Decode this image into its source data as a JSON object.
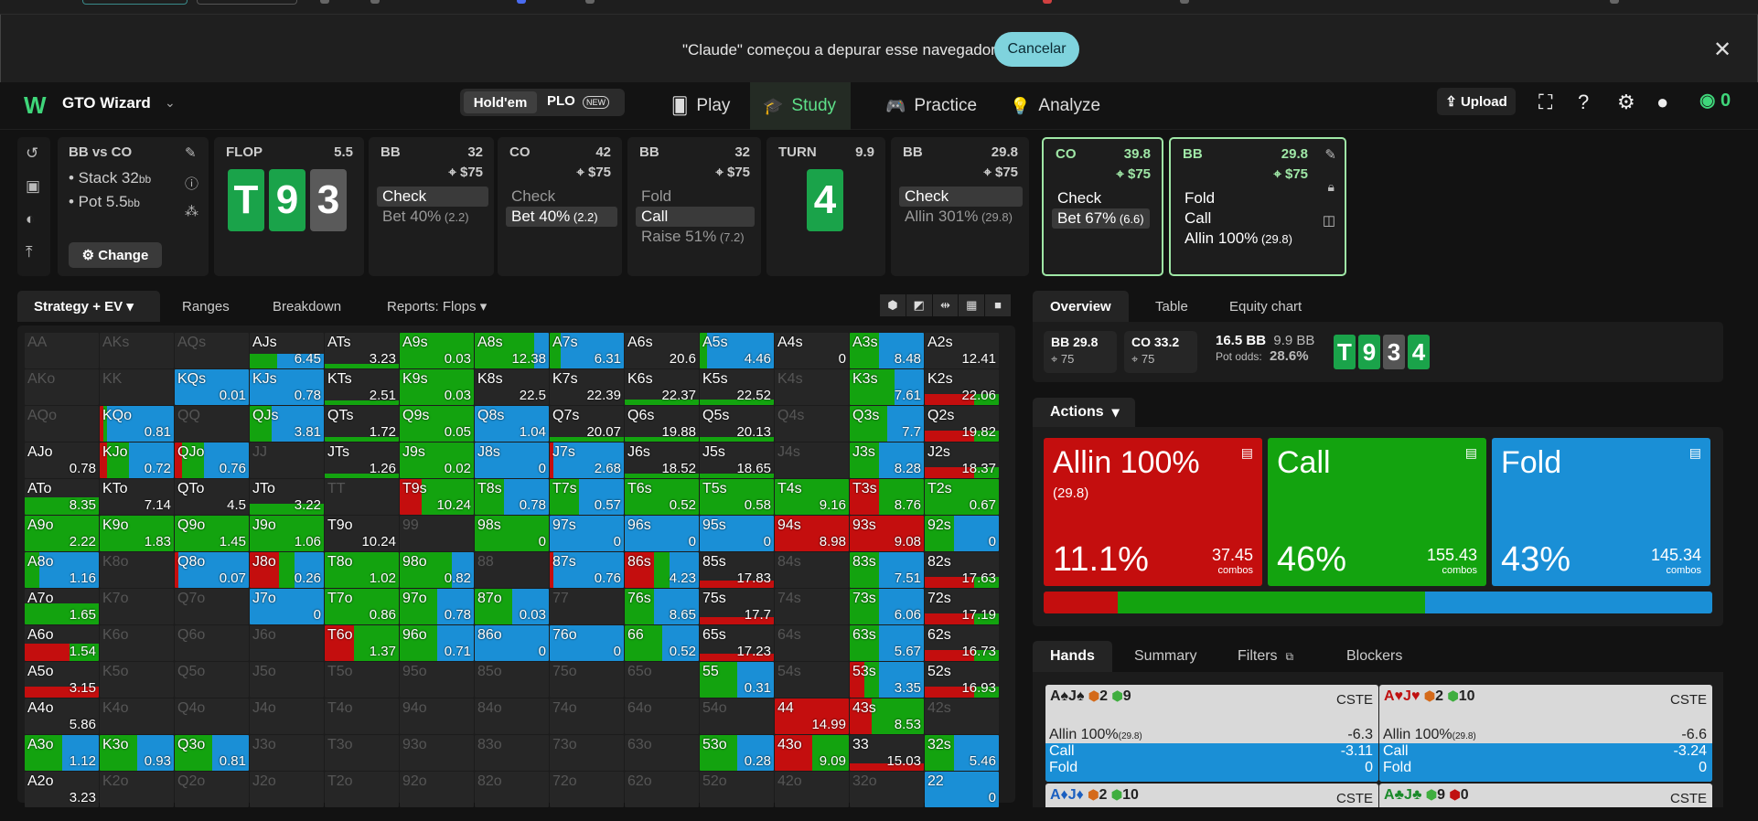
{
  "browser_infobar": {
    "message": "\"Claude\" começou a depurar esse navegador",
    "cancel_label": "Cancelar",
    "close_glyph": "✕"
  },
  "nav": {
    "brand": "GTO Wizard",
    "logo": "W",
    "game_holdem": "Hold'em",
    "game_plo": "PLO",
    "new_badge": "NEW",
    "play": "Play",
    "study": "Study",
    "practice": "Practice",
    "analyze": "Analyze",
    "upload": "Upload",
    "score": "0"
  },
  "spot": {
    "title": "BB vs CO",
    "stack": "• Stack 32",
    "stack_unit": "bb",
    "pot": "• Pot 5.5",
    "pot_unit": "bb",
    "change": "Change"
  },
  "flop": {
    "label": "FLOP",
    "pot": "5.5",
    "cards": [
      "T",
      "9",
      "3"
    ]
  },
  "turn": {
    "label": "TURN",
    "pot": "9.9",
    "card": "4"
  },
  "nodes": [
    {
      "pos": "BB",
      "stack": "32",
      "pot": "⌖ $75",
      "actions": [
        {
          "t": "Check",
          "s": ""
        },
        {
          "t": "Bet 40%",
          "s": " (2.2)"
        }
      ]
    },
    {
      "pos": "CO",
      "stack": "42",
      "pot": "⌖ $75",
      "actions": [
        {
          "t": "Check",
          "s": ""
        },
        {
          "t": "Bet 40%",
          "s": " (2.2)"
        }
      ]
    },
    {
      "pos": "BB",
      "stack": "32",
      "pot": "⌖ $75",
      "actions": [
        {
          "t": "Fold",
          "s": ""
        },
        {
          "t": "Call",
          "s": ""
        },
        {
          "t": "Raise 51%",
          "s": " (7.2)"
        }
      ]
    },
    {
      "pos": "BB",
      "stack": "29.8",
      "pot": "⌖ $75",
      "actions": [
        {
          "t": "Check",
          "s": ""
        },
        {
          "t": "Allin 301%",
          "s": " (29.8)"
        }
      ]
    },
    {
      "pos": "CO",
      "stack": "39.8",
      "pot": "⌖ $75",
      "actions": [
        {
          "t": "Check",
          "s": ""
        },
        {
          "t": "Bet 67%",
          "s": " (6.6)"
        }
      ]
    },
    {
      "pos": "BB",
      "stack": "29.8",
      "pot": "⌖ $75",
      "actions": [
        {
          "t": "Fold",
          "s": ""
        },
        {
          "t": "Call",
          "s": ""
        },
        {
          "t": "Allin 100%",
          "s": " (29.8)"
        }
      ]
    }
  ],
  "subtabs": {
    "strategy": "Strategy + EV",
    "ranges": "Ranges",
    "breakdown": "Breakdown",
    "reports": "Reports: Flops"
  },
  "right_tabs": {
    "overview": "Overview",
    "table": "Table",
    "equity": "Equity chart"
  },
  "overview": {
    "bb": "BB 29.8",
    "bb_pp": "⌖ 75",
    "co": "CO 33.2",
    "co_pp": "⌖ 75",
    "pot_main": "16.5 BB",
    "pot_side": "9.9 BB",
    "pot_odds_label": "Pot odds:",
    "pot_odds": "28.6%",
    "board": [
      "T",
      "9",
      "3",
      "4"
    ]
  },
  "actions_panel": {
    "header": "Actions",
    "boxes": [
      {
        "label": "Allin 100%",
        "size": "(29.8)",
        "pct": "11.1%",
        "combos": "37.45",
        "combos_label": "combos",
        "color": "#c40e0e"
      },
      {
        "label": "Call",
        "size": "",
        "pct": "46%",
        "combos": "155.43",
        "combos_label": "combos",
        "color": "#13a30f"
      },
      {
        "label": "Fold",
        "size": "",
        "pct": "43%",
        "combos": "145.34",
        "combos_label": "combos",
        "color": "#1a8fd6"
      }
    ],
    "freq": [
      0.111,
      0.46,
      0.43
    ]
  },
  "hands_tabs": {
    "hands": "Hands",
    "summary": "Summary",
    "filters": "Filters",
    "blockers": "Blockers"
  },
  "hand_cards": [
    {
      "cards": "A♠J♠",
      "b1": "2",
      "b2": "9",
      "code": "CSTE",
      "allin": "Allin 100%",
      "allin_s": "(29.8)",
      "allin_v": "-6.3",
      "call_v": "-3.11",
      "fold_v": "0"
    },
    {
      "cards": "A♥J♥",
      "b1": "2",
      "b2": "10",
      "code": "CSTE",
      "allin": "Allin 100%",
      "allin_s": "(29.8)",
      "allin_v": "-6.6",
      "call_v": "-3.24",
      "fold_v": "0"
    },
    {
      "cards": "A♦J♦",
      "b1": "2",
      "b2": "10",
      "code": "CSTE"
    },
    {
      "cards": "A♣J♣",
      "b1": "9",
      "b2": "0",
      "code": "CSTE"
    }
  ],
  "labels": {
    "call": "Call",
    "fold": "Fold"
  },
  "colors": {
    "allin": "#c40e0e",
    "call": "#13a30f",
    "fold": "#1a8fd6",
    "accent": "#3fd67a"
  },
  "grid": [
    [
      "AA|x",
      "AKs|x",
      "AQs|x",
      "AJs|6.45|0,15,25",
      "ATs|3.23|0,5,0",
      "A9s|0.03|0,100,0",
      "A8s|12.38|0,80,20",
      "A7s|6.31|0,15,85",
      "A6s|20.6|0,0,0",
      "A5s|4.46|0,10,90",
      "A4s|0|0,0,0",
      "A3s|8.48|0,40,60",
      "A2s|12.41|0,0,0"
    ],
    [
      "AKo|x",
      "KK|x",
      "KQs|0.01|0,0,100",
      "KJs|0.78|0,0,100",
      "KTs|2.51|0,5,0",
      "K9s|0.03|0,100,0",
      "K8s|22.5|0,0,0",
      "K7s|22.39|0,0,0",
      "K6s|22.37|0,15,0",
      "K5s|22.52|0,15,0",
      "K4s|x",
      "K3s|7.61|0,60,40",
      "K2s|22.06|20,10,0"
    ],
    [
      "AQo|x",
      "KQo|0.81|5,5,90",
      "QQ|x",
      "QJs|3.81|0,30,70",
      "QTs|1.72|0,5,0",
      "Q9s|0.05|0,100,0",
      "Q8s|1.04|0,0,100",
      "Q7s|20.07|0,5,0",
      "Q6s|19.88|0,5,0",
      "Q5s|20.13|0,10,0",
      "Q4s|x",
      "Q3s|7.7|0,50,50",
      "Q2s|19.82|20,10,0"
    ],
    [
      "AJo|0.78|0,0,0",
      "KJo|0.72|10,30,60",
      "QJo|0.76|10,30,60",
      "JJ|x",
      "JTs|1.26|0,5,0",
      "J9s|0.02|0,100,0",
      "J8s|0|0,0,100",
      "J7s|2.68|5,0,95",
      "J6s|18.52|0,5,0",
      "J5s|18.65|0,5,0",
      "J4s|x",
      "J3s|8.28|0,40,60",
      "J2s|18.37|20,10,0"
    ],
    [
      "ATo|8.35|0,50,0",
      "KTo|7.14|0,0,0",
      "QTo|4.5|0,0,0",
      "JTo|3.22|0,30,0",
      "TT|x",
      "T9s|10.24|30,70,0",
      "T8s|0.78|0,40,60",
      "T7s|0.57|0,40,60",
      "T6s|0.52|0,100,0",
      "T5s|0.58|0,100,0",
      "T4s|9.16|0,100,0",
      "T3s|8.76|40,60,0",
      "T2s|0.67|0,100,0"
    ],
    [
      "A9o|2.22|0,100,0",
      "K9o|1.83|0,100,0",
      "Q9o|1.45|0,100,0",
      "J9o|1.06|0,100,0",
      "T9o|10.24|0,0,0",
      "99|x",
      "98s|0|0,100,0",
      "97s|0|0,0,100",
      "96s|0|0,0,100",
      "95s|0|0,0,100",
      "94s|8.98|100,0,0",
      "93s|9.08|100,0,0",
      "92s|0|0,40,60"
    ],
    [
      "A8o|1.16|0,20,80",
      "K8o|x",
      "Q8o|0.07|5,0,95",
      "J8o|0.26|40,20,40",
      "T8o|1.02|0,100,0",
      "98o|0.82|0,70,30",
      "88|x",
      "87s|0.76|5,0,95",
      "86s|4.23|40,20,40",
      "85s|17.83|20,0,0",
      "84s|x",
      "83s|7.51|0,40,60",
      "82s|17.63|20,10,0"
    ],
    [
      "A7o|1.65|0,60,0",
      "K7o|x",
      "Q7o|x",
      "J7o|0|0,0,100",
      "T7o|0.86|0,100,0",
      "97o|0.78|0,50,50",
      "87o|0.03|0,50,50",
      "77|x",
      "76s|8.65|0,40,60",
      "75s|17.7|20,0,0",
      "74s|x",
      "73s|6.06|0,40,60",
      "72s|17.19|20,10,0"
    ],
    [
      "A6o|1.54|30,20,0",
      "K6o|x",
      "Q6o|x",
      "J6o|x",
      "T6o|1.37|40,60,0",
      "96o|0.71|0,50,50",
      "86o|0|0,0,100",
      "76o|0|0,0,100",
      "66|0.52|0,50,50",
      "65s|17.23|20,0,0",
      "64s|x",
      "63s|5.67|0,40,60",
      "62s|16.73|20,10,0"
    ],
    [
      "A5o|3.15|30,0,0",
      "K5o|x",
      "Q5o|x",
      "J5o|x",
      "T5o|x",
      "95o|x",
      "85o|x",
      "75o|x",
      "65o|x",
      "55|0.31|0,50,50",
      "54s|x",
      "53s|3.35|20,20,60",
      "52s|16.93|20,10,0"
    ],
    [
      "A4o|5.86|0,0,0",
      "K4o|x",
      "Q4o|x",
      "J4o|x",
      "T4o|x",
      "94o|x",
      "84o|x",
      "74o|x",
      "64o|x",
      "54o|x",
      "44|14.99|100,0,0",
      "43s|8.53|30,70,0",
      "42s|x"
    ],
    [
      "A3o|1.12|0,50,50",
      "K3o|0.93|0,50,50",
      "Q3o|0.81|0,50,50",
      "J3o|x",
      "T3o|x",
      "93o|x",
      "83o|x",
      "73o|x",
      "63o|x",
      "53o|0.28|0,50,50",
      "43o|9.09|50,50,0",
      "33|15.03|20,0,0",
      "32s|5.46|0,40,60"
    ],
    [
      "A2o|3.23|0,0,0",
      "K2o|x",
      "Q2o|x",
      "J2o|x",
      "T2o|x",
      "92o|x",
      "82o|x",
      "72o|x",
      "62o|x",
      "52o|x",
      "42o|x",
      "32o|x",
      "22|0|0,0,100"
    ]
  ]
}
